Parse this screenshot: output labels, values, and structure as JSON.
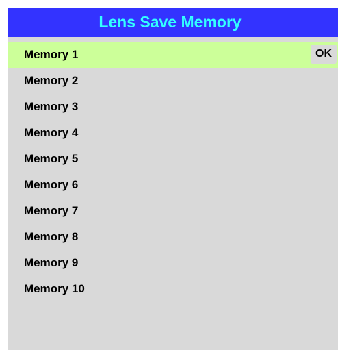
{
  "window": {
    "title": "Lens Save Memory"
  },
  "menu": {
    "selected_index": 0,
    "ok_label": "OK",
    "items": [
      {
        "label": "Memory 1"
      },
      {
        "label": "Memory 2"
      },
      {
        "label": "Memory 3"
      },
      {
        "label": "Memory 4"
      },
      {
        "label": "Memory 5"
      },
      {
        "label": "Memory 6"
      },
      {
        "label": "Memory 7"
      },
      {
        "label": "Memory 8"
      },
      {
        "label": "Memory 9"
      },
      {
        "label": "Memory 10"
      }
    ]
  },
  "colors": {
    "header_background": "#3333ff",
    "header_text": "#33ffff",
    "panel_background": "#d9d9d9",
    "selected_row": "#ccff99",
    "item_text": "#000000"
  }
}
